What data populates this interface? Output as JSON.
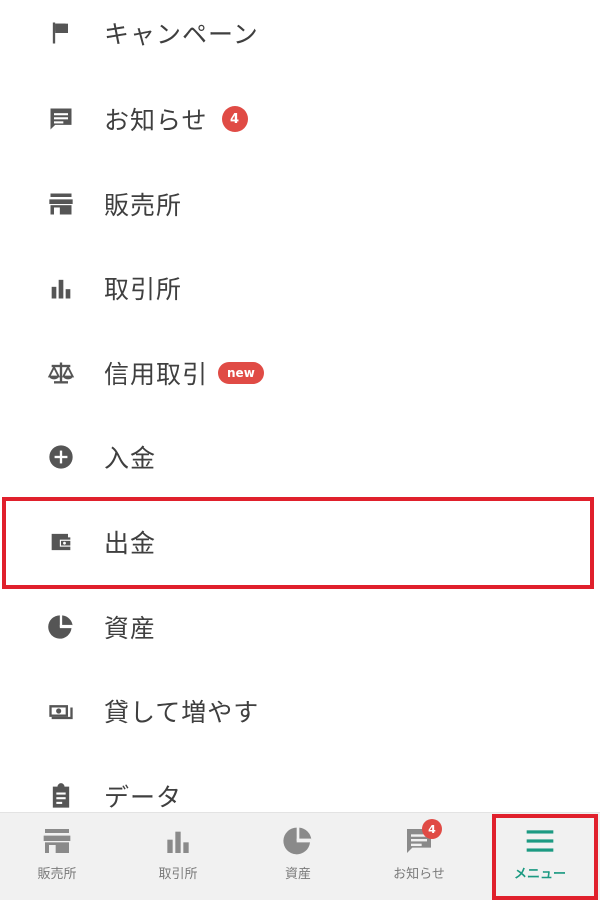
{
  "menu": {
    "items": [
      {
        "label": "キャンペーン",
        "icon": "flag-icon"
      },
      {
        "label": "お知らせ",
        "icon": "message-icon",
        "badge": "4"
      },
      {
        "label": "販売所",
        "icon": "store-icon"
      },
      {
        "label": "取引所",
        "icon": "bar-chart-icon"
      },
      {
        "label": "信用取引",
        "icon": "scale-icon",
        "badge": "new"
      },
      {
        "label": "入金",
        "icon": "plus-circle-icon"
      },
      {
        "label": "出金",
        "icon": "wallet-icon"
      },
      {
        "label": "資産",
        "icon": "pie-chart-icon"
      },
      {
        "label": "貸して増やす",
        "icon": "money-icon"
      },
      {
        "label": "データ",
        "icon": "clipboard-icon"
      }
    ]
  },
  "bottom_nav": {
    "items": [
      {
        "label": "販売所",
        "icon": "store-icon"
      },
      {
        "label": "取引所",
        "icon": "bar-chart-icon"
      },
      {
        "label": "資産",
        "icon": "pie-chart-icon"
      },
      {
        "label": "お知らせ",
        "icon": "message-icon",
        "badge": "4"
      },
      {
        "label": "メニュー",
        "icon": "menu-icon",
        "active": true
      }
    ]
  },
  "colors": {
    "accent": "#1c9a82",
    "badge": "#e04b45",
    "highlight": "#e0202c"
  }
}
